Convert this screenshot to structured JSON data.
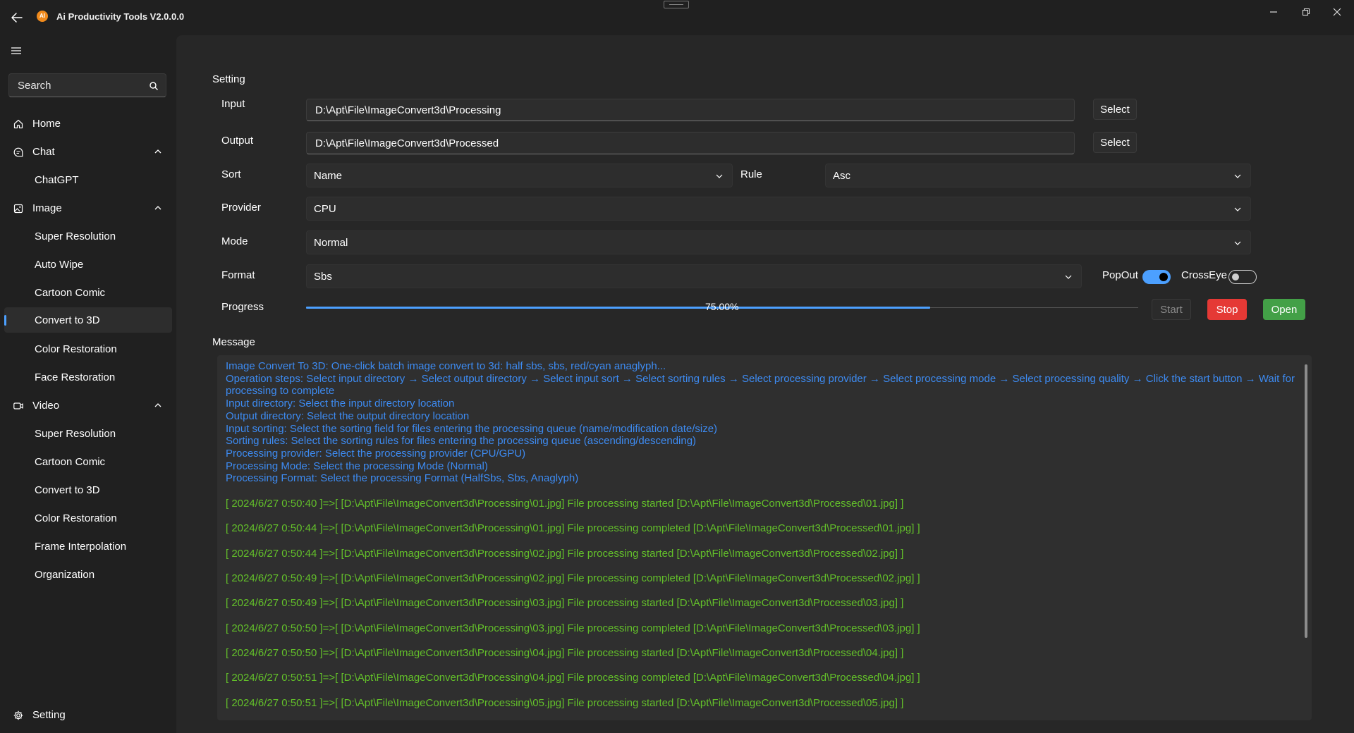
{
  "window": {
    "title": "Ai Productivity Tools V2.0.0.0",
    "logo_text": "AI"
  },
  "sidebar": {
    "search_placeholder": "Search",
    "items": [
      {
        "label": "Home"
      },
      {
        "label": "Chat"
      },
      {
        "label": "ChatGPT"
      },
      {
        "label": "Image"
      },
      {
        "label": "Super Resolution"
      },
      {
        "label": "Auto Wipe"
      },
      {
        "label": "Cartoon Comic"
      },
      {
        "label": "Convert to 3D"
      },
      {
        "label": "Color Restoration"
      },
      {
        "label": "Face Restoration"
      },
      {
        "label": "Video"
      },
      {
        "label": "Super Resolution"
      },
      {
        "label": "Cartoon Comic"
      },
      {
        "label": "Convert to 3D"
      },
      {
        "label": "Color Restoration"
      },
      {
        "label": "Frame Interpolation"
      },
      {
        "label": "Organization"
      }
    ],
    "setting_label": "Setting"
  },
  "main": {
    "setting_title": "Setting",
    "input": {
      "label": "Input",
      "value": "D:\\Apt\\File\\ImageConvert3d\\Processing",
      "button": "Select"
    },
    "output": {
      "label": "Output",
      "value": "D:\\Apt\\File\\ImageConvert3d\\Processed",
      "button": "Select"
    },
    "sort": {
      "label": "Sort",
      "value": "Name"
    },
    "rule": {
      "label": "Rule",
      "value": "Asc"
    },
    "provider": {
      "label": "Provider",
      "value": "CPU"
    },
    "mode": {
      "label": "Mode",
      "value": "Normal"
    },
    "format": {
      "label": "Format",
      "value": "Sbs"
    },
    "popout": {
      "label": "PopOut",
      "on": true
    },
    "crosseye": {
      "label": "CrossEye",
      "on": false
    },
    "progress": {
      "label": "Progress",
      "percent": 75,
      "text": "75.00%"
    },
    "buttons": {
      "start": "Start",
      "stop": "Stop",
      "open": "Open"
    },
    "message_title": "Message",
    "info_lines": [
      "Image Convert To 3D: One-click batch image convert to 3d: half sbs, sbs, red/cyan anaglyph...",
      "Operation steps: Select input directory → Select output directory → Select input sort → Select sorting rules → Select processing provider → Select processing mode → Select processing quality → Click the start button → Wait for processing to complete",
      "Input directory: Select the input directory location",
      "Output directory: Select the output directory location",
      "Input sorting: Select the sorting field for files entering the processing queue (name/modification date/size)",
      "Sorting rules: Select the sorting rules for files entering the processing queue (ascending/descending)",
      "Processing provider: Select the processing provider (CPU/GPU)",
      "Processing Mode: Select the processing Mode (Normal)",
      "Processing Format: Select the processing Format (HalfSbs, Sbs, Anaglyph)"
    ],
    "log_lines": [
      "[ 2024/6/27 0:50:40 ]=>[ [D:\\Apt\\File\\ImageConvert3d\\Processing\\01.jpg] File processing started [D:\\Apt\\File\\ImageConvert3d\\Processed\\01.jpg] ]",
      "[ 2024/6/27 0:50:44 ]=>[ [D:\\Apt\\File\\ImageConvert3d\\Processing\\01.jpg] File processing completed [D:\\Apt\\File\\ImageConvert3d\\Processed\\01.jpg] ]",
      "[ 2024/6/27 0:50:44 ]=>[ [D:\\Apt\\File\\ImageConvert3d\\Processing\\02.jpg] File processing started [D:\\Apt\\File\\ImageConvert3d\\Processed\\02.jpg] ]",
      "[ 2024/6/27 0:50:49 ]=>[ [D:\\Apt\\File\\ImageConvert3d\\Processing\\02.jpg] File processing completed [D:\\Apt\\File\\ImageConvert3d\\Processed\\02.jpg] ]",
      "[ 2024/6/27 0:50:49 ]=>[ [D:\\Apt\\File\\ImageConvert3d\\Processing\\03.jpg] File processing started [D:\\Apt\\File\\ImageConvert3d\\Processed\\03.jpg] ]",
      "[ 2024/6/27 0:50:50 ]=>[ [D:\\Apt\\File\\ImageConvert3d\\Processing\\03.jpg] File processing completed [D:\\Apt\\File\\ImageConvert3d\\Processed\\03.jpg] ]",
      "[ 2024/6/27 0:50:50 ]=>[ [D:\\Apt\\File\\ImageConvert3d\\Processing\\04.jpg] File processing started [D:\\Apt\\File\\ImageConvert3d\\Processed\\04.jpg] ]",
      "[ 2024/6/27 0:50:51 ]=>[ [D:\\Apt\\File\\ImageConvert3d\\Processing\\04.jpg] File processing completed [D:\\Apt\\File\\ImageConvert3d\\Processed\\04.jpg] ]",
      "[ 2024/6/27 0:50:51 ]=>[ [D:\\Apt\\File\\ImageConvert3d\\Processing\\05.jpg] File processing started [D:\\Apt\\File\\ImageConvert3d\\Processed\\05.jpg] ]"
    ]
  },
  "colors": {
    "accent": "#4ca0ff",
    "info_text": "#3d8bf2",
    "log_text": "#63c02a",
    "stop": "#e53935",
    "open": "#43a047"
  },
  "icons": {
    "back": "arrow-left-icon",
    "menu": "hamburger-icon",
    "search": "search-icon",
    "home": "home-icon",
    "chat": "chat-bubble-icon",
    "image": "image-icon",
    "video": "video-camera-icon",
    "setting": "gear-icon",
    "expand": "chevron-up-icon",
    "dropdown": "chevron-down-icon"
  }
}
